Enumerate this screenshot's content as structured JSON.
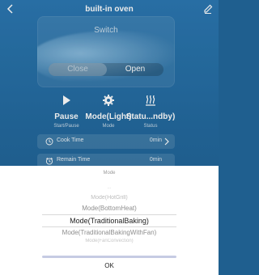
{
  "header": {
    "title": "built-in oven"
  },
  "device_card": {
    "switch_label": "Switch",
    "close_label": "Close",
    "open_label": "Open"
  },
  "controls": [
    {
      "label": "Pause",
      "sub": "Start/Pause"
    },
    {
      "label": "Mode(Light)",
      "sub": "Mode"
    },
    {
      "label": "Statu...ndby)",
      "sub": "Status"
    }
  ],
  "rows": {
    "cook_time": {
      "label": "Cook Time",
      "value": "0min"
    },
    "remain_time": {
      "label": "Remain Time",
      "value": "0min"
    }
  },
  "picker": {
    "title": "Mode",
    "options": [
      "Mode(HotGrill)",
      "Mode(BottomHeat)",
      "Mode(TraditionalBaking)",
      "Mode(TraditionalBakingWithFan)",
      "Mode(FanConvection)"
    ],
    "above_faded": "...",
    "selected": "Mode(TraditionalBaking)",
    "ok_label": "OK"
  },
  "colors": {
    "background": "#236a9f",
    "sheet": "#ffffff",
    "divider": "#c6cbe3"
  },
  "icons": {
    "back": "back-arrow-icon",
    "edit": "pencil-icon",
    "pause": "play-icon",
    "mode": "gear-icon",
    "status": "steam-icon",
    "cook_time": "clock-icon",
    "remain_time": "alarm-clock-icon",
    "chevron": "chevron-right-icon"
  }
}
